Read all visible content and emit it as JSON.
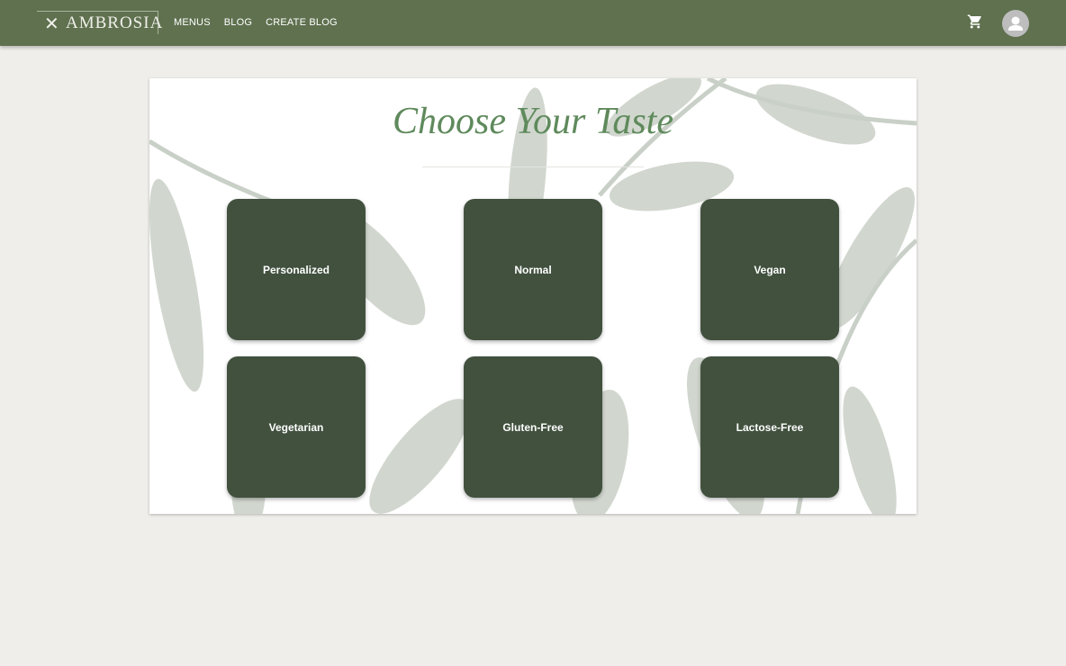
{
  "nav": {
    "brand": "AMBROSIA",
    "links": [
      "MENUS",
      "BLOG",
      "CREATE BLOG"
    ]
  },
  "main": {
    "title": "Choose Your Taste",
    "options": [
      "Personalized",
      "Normal",
      "Vegan",
      "Vegetarian",
      "Gluten-Free",
      "Lactose-Free"
    ]
  },
  "colors": {
    "nav": "#5f714f",
    "tile": "#41513e",
    "title": "#5f8a5c"
  }
}
